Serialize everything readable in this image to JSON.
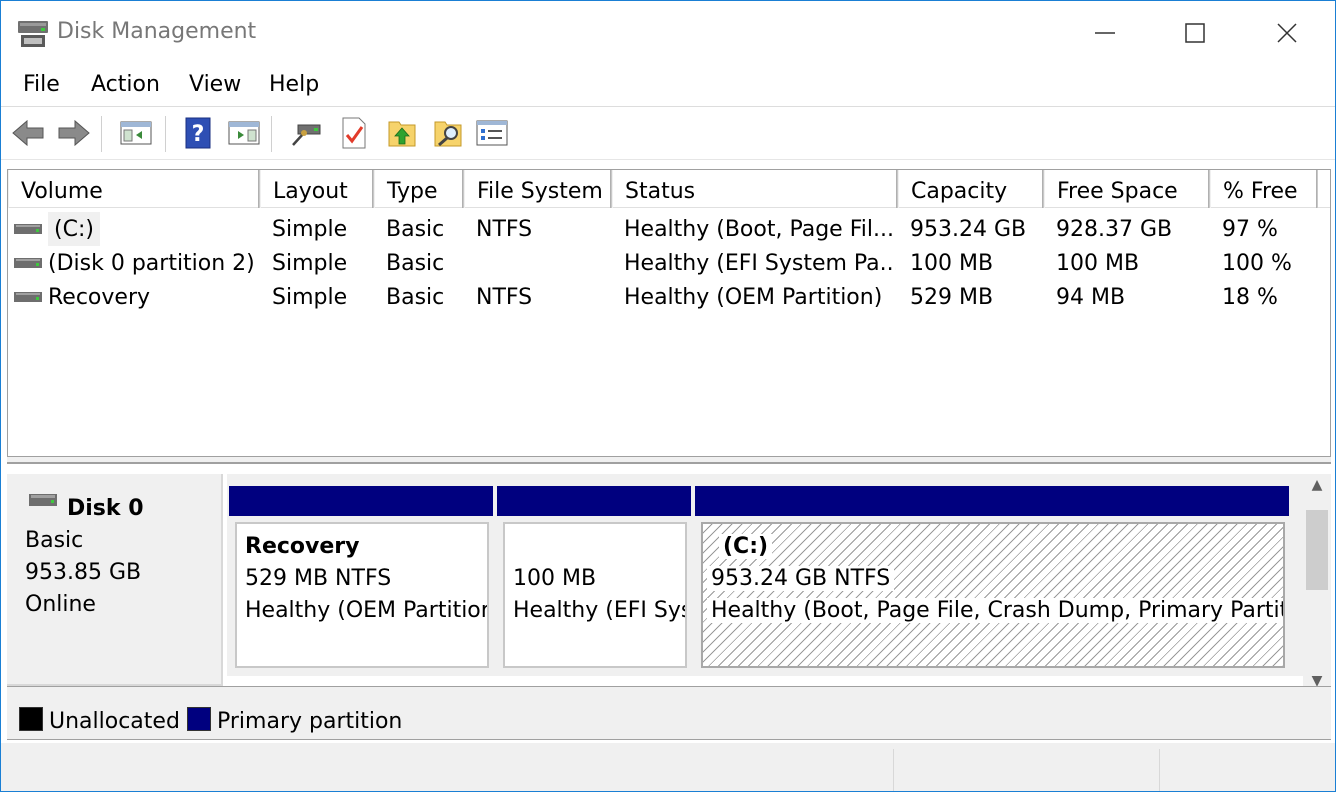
{
  "window": {
    "title": "Disk Management"
  },
  "menu": [
    {
      "label": "File"
    },
    {
      "label": "Action"
    },
    {
      "label": "View"
    },
    {
      "label": "Help"
    }
  ],
  "toolbar": {
    "icons": [
      "back-arrow-icon",
      "forward-arrow-icon",
      "console-tree-icon",
      "help-icon",
      "action-pane-icon",
      "connect-disk-icon",
      "checklist-icon",
      "up-folder-icon",
      "search-folder-icon",
      "properties-icon"
    ]
  },
  "volume_list": {
    "columns": [
      "Volume",
      "Layout",
      "Type",
      "File System",
      "Status",
      "Capacity",
      "Free Space",
      "% Free"
    ],
    "rows": [
      {
        "volume": "(C:)",
        "layout": "Simple",
        "type": "Basic",
        "file_system": "NTFS",
        "status": "Healthy (Boot, Page Fil...",
        "capacity": "953.24 GB",
        "free_space": "928.37 GB",
        "pct_free": "97 %"
      },
      {
        "volume": "(Disk 0 partition 2)",
        "layout": "Simple",
        "type": "Basic",
        "file_system": "",
        "status": "Healthy (EFI System Pa...",
        "capacity": "100 MB",
        "free_space": "100 MB",
        "pct_free": "100 %"
      },
      {
        "volume": "Recovery",
        "layout": "Simple",
        "type": "Basic",
        "file_system": "NTFS",
        "status": "Healthy (OEM Partition)",
        "capacity": "529 MB",
        "free_space": "94 MB",
        "pct_free": "18 %"
      }
    ]
  },
  "disk": {
    "name": "Disk 0",
    "type": "Basic",
    "size": "953.85 GB",
    "state": "Online",
    "partitions": [
      {
        "name": "Recovery",
        "size_fs": "529 MB NTFS",
        "status": "Healthy (OEM Partitior"
      },
      {
        "name": "",
        "size_fs": "100 MB",
        "status": "Healthy (EFI Sys"
      },
      {
        "name": "(C:)",
        "size_fs": "953.24 GB NTFS",
        "status": "Healthy (Boot, Page File, Crash Dump, Primary Partitic"
      }
    ]
  },
  "legend": {
    "unallocated_label": "Unallocated",
    "unallocated_color": "#000000",
    "primary_label": "Primary partition",
    "primary_color": "#00007f"
  },
  "colors": {
    "window_border": "#1a7fd4",
    "partition_bar": "#00007f",
    "panel_bg": "#f0f0f0"
  }
}
